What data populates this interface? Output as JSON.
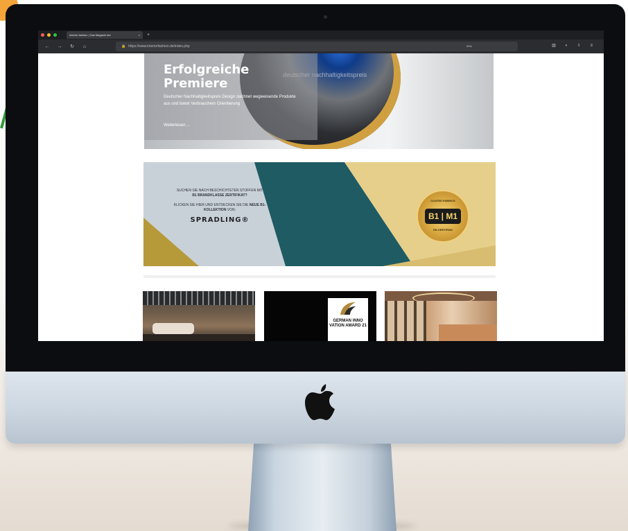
{
  "browser": {
    "tab_title": "Interior fashion | Das Magazin der",
    "tab_close": "×",
    "new_tab": "+",
    "url": "https://www.interiorfashion.de/index.php",
    "zoom": "90%"
  },
  "hero": {
    "title": "Erfolgreiche Premiere",
    "text": "Deutscher Nachhaltigkeitspreis Design zeichnet wegweisende Produkte aus und bietet Verbrauchern Orientierung",
    "more_link": "Weiterlesen ...",
    "watermark": "deutscher nachhaltigkeitspreis"
  },
  "banner": {
    "line1": "SUCHEN SIE NACH BESCHICHTETEN STOFFEN MIT",
    "line2": "B1 BRANDKLASSE ZERTIFIKAT?",
    "line3": "KLICKEN SIE HIER UND ENTDECKEN SIE DIE",
    "line3_bold": "NEUE B1-KOLLEKTION",
    "line3_end": "VON:",
    "brand": "SPRADLING®",
    "seal_top": "COATED FABRICS",
    "seal_main": "B1 | M1",
    "seal_bottom": "EN CERTIFIED"
  },
  "award": {
    "text": "GERMAN INNO VATION AWARD 21"
  },
  "colors": {
    "bezel": "#0c0d10",
    "teal": "#1f5b63",
    "gold": "#e6cf8a",
    "olive": "#b69a3a"
  }
}
